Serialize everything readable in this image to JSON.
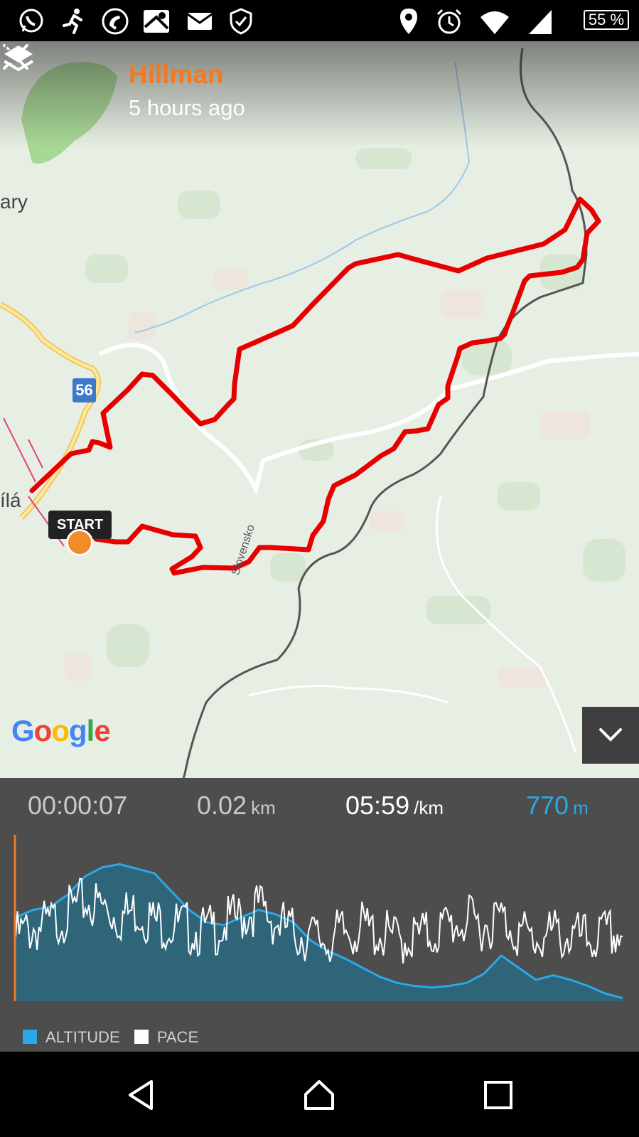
{
  "status_bar": {
    "battery": "55 %",
    "icons": [
      "whatsapp-icon",
      "runner-icon",
      "phone-icon",
      "maps-icon",
      "mail-icon",
      "shield-icon",
      "location-icon",
      "alarm-icon",
      "wifi-icon",
      "signal-icon",
      "battery-icon"
    ]
  },
  "header": {
    "title": "Hillman",
    "subtitle": "5 hours ago"
  },
  "map": {
    "place_label_1": "ary",
    "place_label_2": "ílá",
    "road_number": "56",
    "road_label": "Slovensko",
    "start_label": "START",
    "attribution": "Google",
    "route_color": "#e60000",
    "start_color": "#f48a28"
  },
  "stats": {
    "duration": "00:00:07",
    "distance_value": "0.02",
    "distance_unit": "km",
    "pace_value": "05:59",
    "pace_unit": "/km",
    "altitude_value": "770",
    "altitude_unit": "m"
  },
  "legend": {
    "altitude": "ALTITUDE",
    "pace": "PACE",
    "altitude_color": "#29a9e8",
    "pace_color": "#ffffff"
  },
  "chart_data": {
    "type": "area",
    "series": [
      {
        "name": "ALTITUDE",
        "values": [
          0.55,
          0.6,
          0.62,
          0.7,
          0.82,
          0.88,
          0.9,
          0.87,
          0.84,
          0.72,
          0.6,
          0.52,
          0.5,
          0.55,
          0.6,
          0.57,
          0.52,
          0.4,
          0.33,
          0.28,
          0.22,
          0.16,
          0.12,
          0.1,
          0.09,
          0.1,
          0.12,
          0.18,
          0.3,
          0.22,
          0.14,
          0.17,
          0.14,
          0.1,
          0.05,
          0.02
        ]
      },
      {
        "name": "PACE",
        "values": [
          0.42,
          0.48,
          0.5,
          0.58,
          0.65,
          0.62,
          0.55,
          0.6,
          0.52,
          0.5,
          0.48,
          0.45,
          0.5,
          0.55,
          0.62,
          0.52,
          0.45,
          0.42,
          0.4,
          0.45,
          0.48,
          0.44,
          0.4,
          0.42,
          0.44,
          0.5,
          0.52,
          0.5,
          0.55,
          0.45,
          0.4,
          0.44,
          0.42,
          0.4,
          0.43,
          0.45
        ]
      }
    ]
  }
}
